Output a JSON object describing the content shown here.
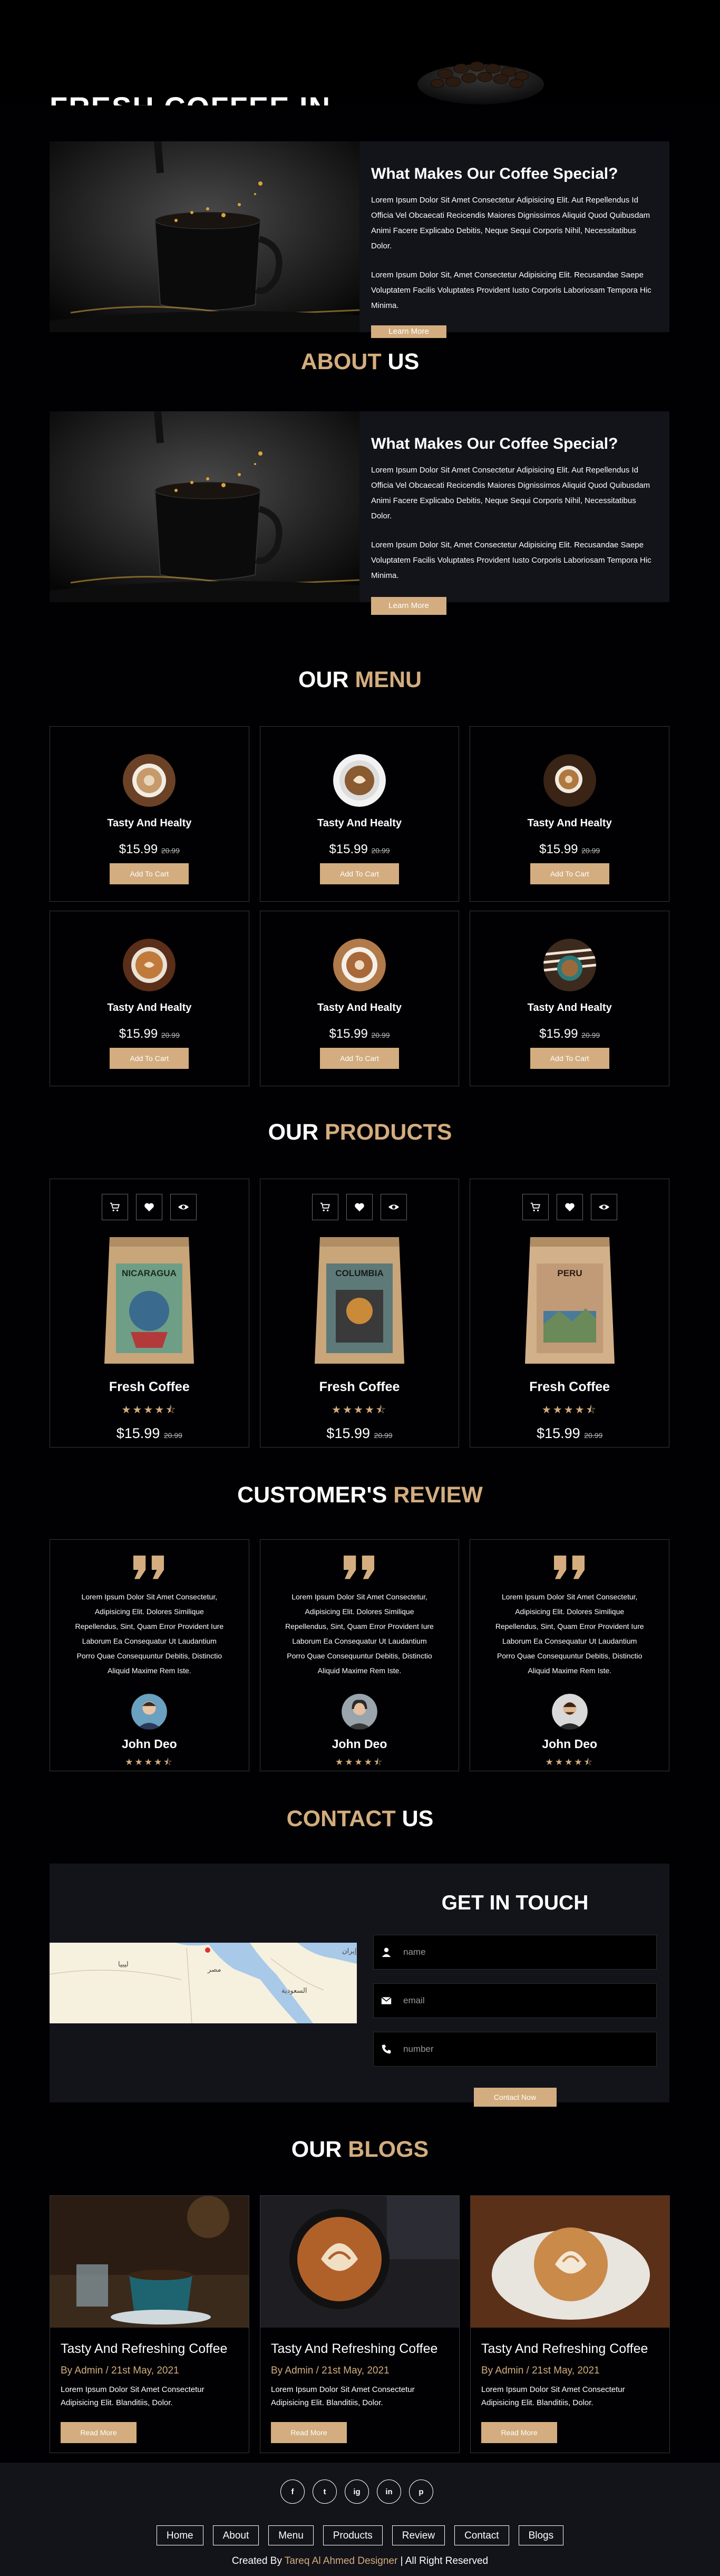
{
  "hero": {
    "title": "FRESH COFFEE IN"
  },
  "about_top": {
    "heading": "What Makes Our Coffee Special?",
    "p1": "Lorem Ipsum Dolor Sit Amet Consectetur Adipisicing Elit. Aut Repellendus Id Officia Vel Obcaecati Recicendis Maiores Dignissimos Aliquid Quod Quibusdam Animi Facere Explicabo Debitis, Neque Sequi Corporis Nihil, Necessitatibus Dolor.",
    "p2": "Lorem Ipsum Dolor Sit, Amet Consectetur Adipisicing Elit. Recusandae Saepe Voluptatem Facilis Voluptates Provident Iusto Corporis Laboriosam Tempora Hic Minima.",
    "button": "Learn More"
  },
  "about": {
    "title_a": "ABOUT",
    "title_b": " US",
    "heading": "What Makes Our Coffee Special?",
    "p1": "Lorem Ipsum Dolor Sit Amet Consectetur Adipisicing Elit. Aut Repellendus Id Officia Vel Obcaecati Recicendis Maiores Dignissimos Aliquid Quod Quibusdam Animi Facere Explicabo Debitis, Neque Sequi Corporis Nihil, Necessitatibus Dolor.",
    "p2": "Lorem Ipsum Dolor Sit, Amet Consectetur Adipisicing Elit. Recusandae Saepe Voluptatem Facilis Voluptates Provident Iusto Corporis Laboriosam Tempora Hic Minima.",
    "button": "Learn More"
  },
  "menu": {
    "title_a": "OUR",
    "title_b": " MENU",
    "items": [
      {
        "name": "Tasty And Healty",
        "price": "$15.99",
        "old": "20.99",
        "button": "Add To Cart"
      },
      {
        "name": "Tasty And Healty",
        "price": "$15.99",
        "old": "20.99",
        "button": "Add To Cart"
      },
      {
        "name": "Tasty And Healty",
        "price": "$15.99",
        "old": "20.99",
        "button": "Add To Cart"
      },
      {
        "name": "Tasty And Healty",
        "price": "$15.99",
        "old": "20.99",
        "button": "Add To Cart"
      },
      {
        "name": "Tasty And Healty",
        "price": "$15.99",
        "old": "20.99",
        "button": "Add To Cart"
      },
      {
        "name": "Tasty And Healty",
        "price": "$15.99",
        "old": "20.99",
        "button": "Add To Cart"
      }
    ]
  },
  "products": {
    "title_a": "OUR",
    "title_b": " PRODUCTS",
    "items": [
      {
        "name": "Fresh Coffee",
        "price": "$15.99",
        "old": "20.99",
        "rating": 4.5,
        "bag_label": "NICARAGUA",
        "bag_color": "#6f9e86"
      },
      {
        "name": "Fresh Coffee",
        "price": "$15.99",
        "old": "20.99",
        "rating": 4.5,
        "bag_label": "COLUMBIA",
        "bag_color": "#5d7a78"
      },
      {
        "name": "Fresh Coffee",
        "price": "$15.99",
        "old": "20.99",
        "rating": 4.5,
        "bag_label": "PERU",
        "bag_color": "#c19a78"
      }
    ]
  },
  "review": {
    "title_a": "CUSTOMER'S",
    "title_b": " REVIEW",
    "items": [
      {
        "text": "Lorem Ipsum Dolor Sit Amet Consectetur, Adipisicing Elit. Dolores Similique Repellendus, Sint, Quam Error Provident Iure Laborum Ea Consequatur Ut Laudantium Porro Quae Consequuntur Debitis, Distinctio Aliquid Maxime Rem Iste.",
        "name": "John Deo",
        "rating": 4.5
      },
      {
        "text": "Lorem Ipsum Dolor Sit Amet Consectetur, Adipisicing Elit. Dolores Similique Repellendus, Sint, Quam Error Provident Iure Laborum Ea Consequatur Ut Laudantium Porro Quae Consequuntur Debitis, Distinctio Aliquid Maxime Rem Iste.",
        "name": "John Deo",
        "rating": 4.5
      },
      {
        "text": "Lorem Ipsum Dolor Sit Amet Consectetur, Adipisicing Elit. Dolores Similique Repellendus, Sint, Quam Error Provident Iure Laborum Ea Consequatur Ut Laudantium Porro Quae Consequuntur Debitis, Distinctio Aliquid Maxime Rem Iste.",
        "name": "John Deo",
        "rating": 4.5
      }
    ]
  },
  "contact": {
    "title_a": "CONTACT",
    "title_b": " US",
    "form_title": "GET IN TOUCH",
    "name_ph": "name",
    "email_ph": "email",
    "number_ph": "number",
    "button": "Contact Now",
    "map_labels": [
      "إيران",
      "مصر",
      "السعودية",
      "ليبيا"
    ]
  },
  "blogs": {
    "title_a": "OUR",
    "title_b": " BLOGS",
    "items": [
      {
        "title": "Tasty And Refreshing Coffee",
        "meta": "By Admin / 21st May, 2021",
        "text": "Lorem Ipsum Dolor Sit Amet Consectetur Adipisicing Elit. Blanditiis, Dolor.",
        "button": "Read More"
      },
      {
        "title": "Tasty And Refreshing Coffee",
        "meta": "By Admin / 21st May, 2021",
        "text": "Lorem Ipsum Dolor Sit Amet Consectetur Adipisicing Elit. Blanditiis, Dolor.",
        "button": "Read More"
      },
      {
        "title": "Tasty And Refreshing Coffee",
        "meta": "By Admin / 21st May, 2021",
        "text": "Lorem Ipsum Dolor Sit Amet Consectetur Adipisicing Elit. Blanditiis, Dolor.",
        "button": "Read More"
      }
    ]
  },
  "footer": {
    "social": [
      "f",
      "t",
      "ig",
      "in",
      "p"
    ],
    "links": [
      "Home",
      "About",
      "Menu",
      "Products",
      "Review",
      "Contact",
      "Blogs"
    ],
    "credit_a": "Created By ",
    "credit_b": "Tareq Al Ahmed Designer",
    "credit_c": " | All Right Reserved"
  },
  "colors": {
    "accent": "#d3ad7f",
    "bg": "#010103",
    "panel": "#13131a"
  }
}
